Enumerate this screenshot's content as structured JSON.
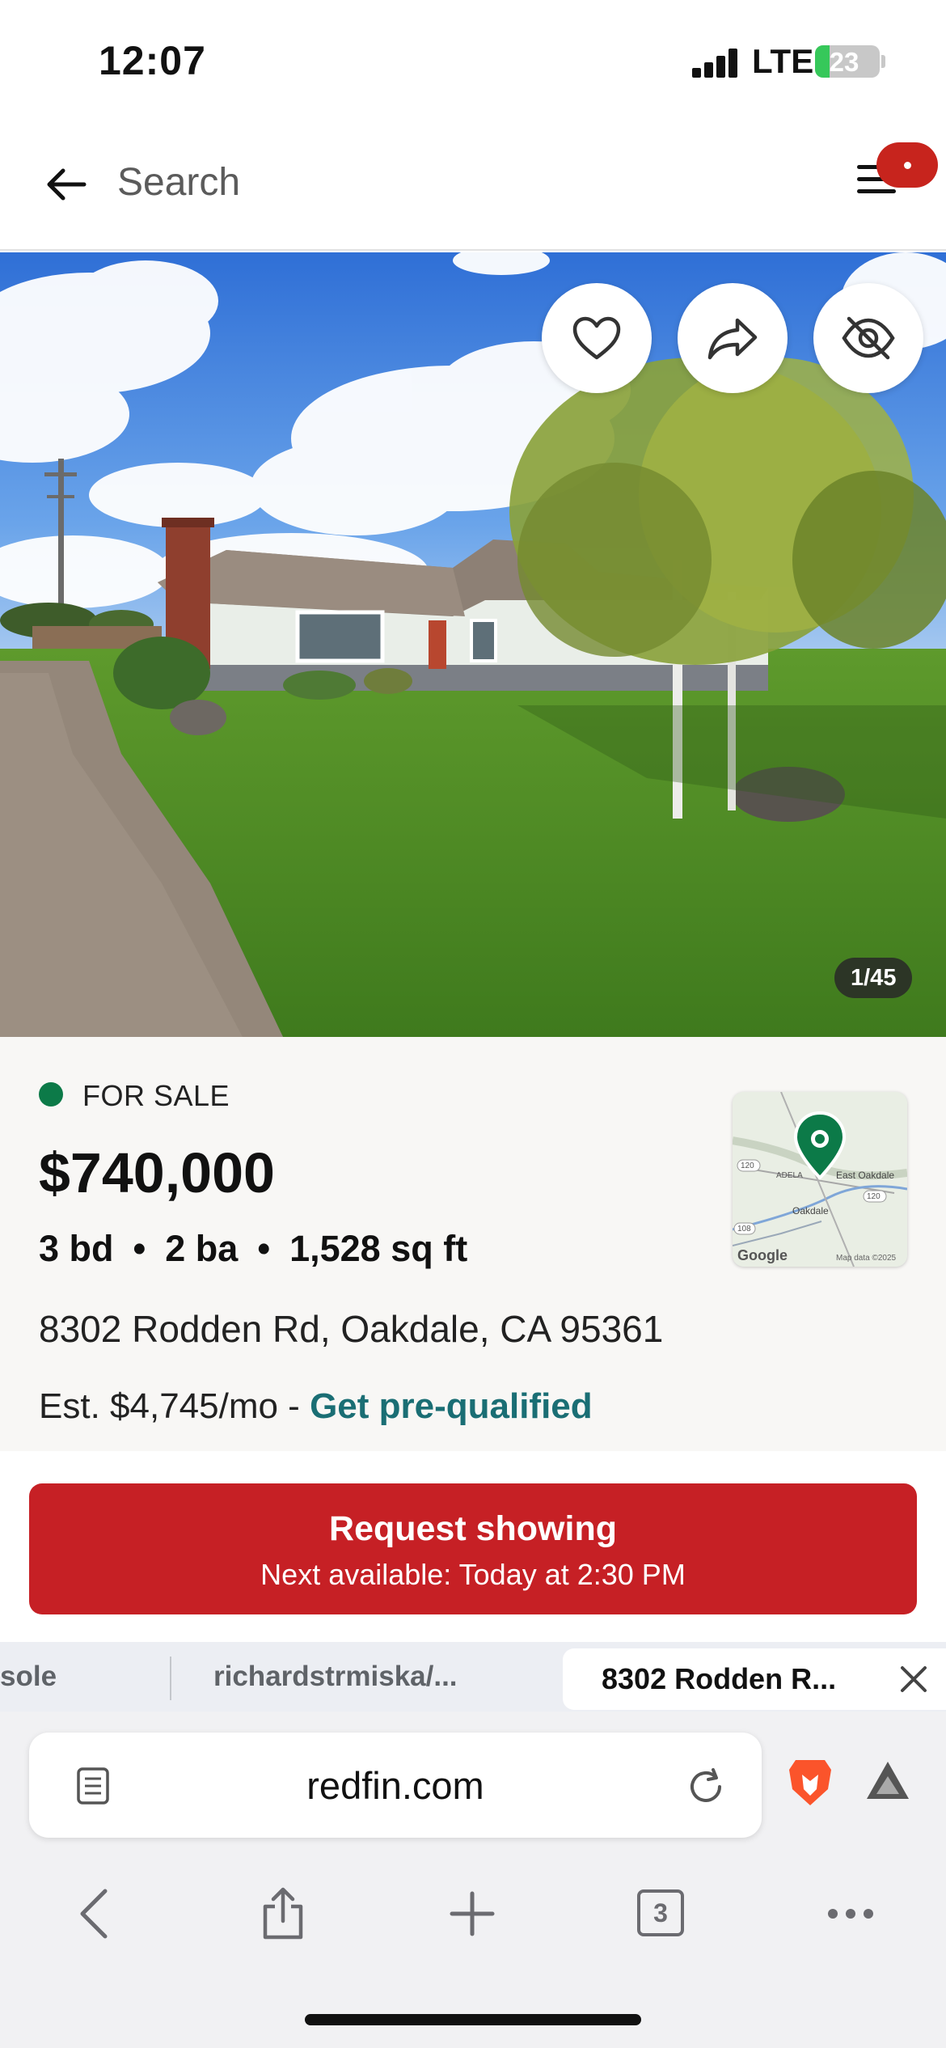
{
  "status_bar": {
    "time": "12:07",
    "network": "LTE",
    "battery": "23",
    "battery_level_percent": 23
  },
  "header": {
    "search_placeholder": "Search",
    "icons": [
      "back-arrow-icon",
      "menu-icon"
    ]
  },
  "photo": {
    "counter": "1/45",
    "actions": [
      "heart-icon",
      "share-icon",
      "hide-icon"
    ]
  },
  "listing": {
    "status": "FOR SALE",
    "status_color": "#0c7a48",
    "price": "$740,000",
    "beds": "3 bd",
    "baths": "2 ba",
    "sqft": "1,528 sq ft",
    "separator": "•",
    "address": "8302 Rodden Rd, Oakdale, CA 95361",
    "estimate": "Est. $4,745/mo - ",
    "prequalify_link": "Get pre-qualified",
    "link_color": "#1a6e74"
  },
  "mini_map": {
    "label_east_oakdale": "East Oakdale",
    "label_oakdale": "Oakdale",
    "label_adela": "ADELA",
    "route_120a": "120",
    "route_120b": "120",
    "route_108": "108",
    "logo": "Google",
    "attribution": "Map data ©2025"
  },
  "cta": {
    "title": "Request showing",
    "subtitle": "Next available: Today at 2:30 PM",
    "color": "#c62025"
  },
  "tabs": {
    "tab1": "sole",
    "tab2": "richardstrmiska/...",
    "active": "8302 Rodden R..."
  },
  "browser": {
    "url": "redfin.com",
    "tab_count": "3",
    "icons": [
      "page-icon",
      "reload-icon",
      "brave-icon",
      "triangle-icon",
      "back-icon",
      "share-icon",
      "new-tab-icon",
      "tabs-icon",
      "more-icon"
    ]
  }
}
